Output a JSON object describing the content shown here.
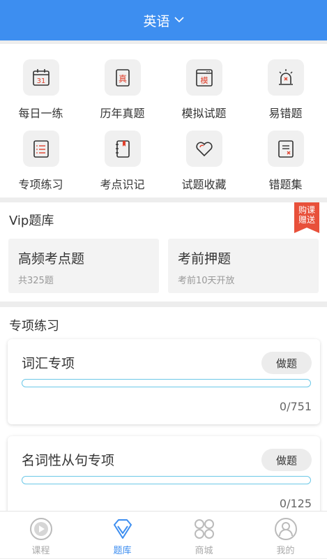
{
  "header": {
    "subject": "英语",
    "chevron_icon": "chevron-down-icon"
  },
  "grid": {
    "items": [
      {
        "label": "每日一练",
        "icon": "calendar-icon",
        "badge": "31"
      },
      {
        "label": "历年真题",
        "icon": "exam-paper-icon",
        "badge": "真"
      },
      {
        "label": "模拟试题",
        "icon": "mock-exam-icon",
        "badge": "模"
      },
      {
        "label": "易错题",
        "icon": "alarm-icon",
        "badge": ""
      },
      {
        "label": "专项练习",
        "icon": "list-doc-icon",
        "badge": ""
      },
      {
        "label": "考点识记",
        "icon": "notebook-icon",
        "badge": ""
      },
      {
        "label": "试题收藏",
        "icon": "heart-icon",
        "badge": ""
      },
      {
        "label": "错题集",
        "icon": "wrong-doc-icon",
        "badge": ""
      }
    ]
  },
  "vip": {
    "title": "Vip题库",
    "ribbon_line1": "购课",
    "ribbon_line2": "赠送",
    "cards": [
      {
        "title": "高频考点题",
        "subtitle": "共325题"
      },
      {
        "title": "考前押题",
        "subtitle": "考前10天开放"
      }
    ]
  },
  "practice": {
    "title": "专项练习",
    "items": [
      {
        "name": "词汇专项",
        "button": "做题",
        "count": "0/751",
        "progress": 0
      },
      {
        "name": "名词性从句专项",
        "button": "做题",
        "count": "0/125",
        "progress": 0
      }
    ]
  },
  "tabbar": {
    "tabs": [
      {
        "label": "课程",
        "icon": "play-circle-icon",
        "active": false
      },
      {
        "label": "题库",
        "icon": "diamond-icon",
        "active": true
      },
      {
        "label": "商城",
        "icon": "grid-circles-icon",
        "active": false
      },
      {
        "label": "我的",
        "icon": "user-icon",
        "active": false
      }
    ]
  },
  "colors": {
    "primary": "#3d8ef0",
    "accent": "#e8503a",
    "progress": "#6cc8e8",
    "icon_red": "#e0402c"
  }
}
